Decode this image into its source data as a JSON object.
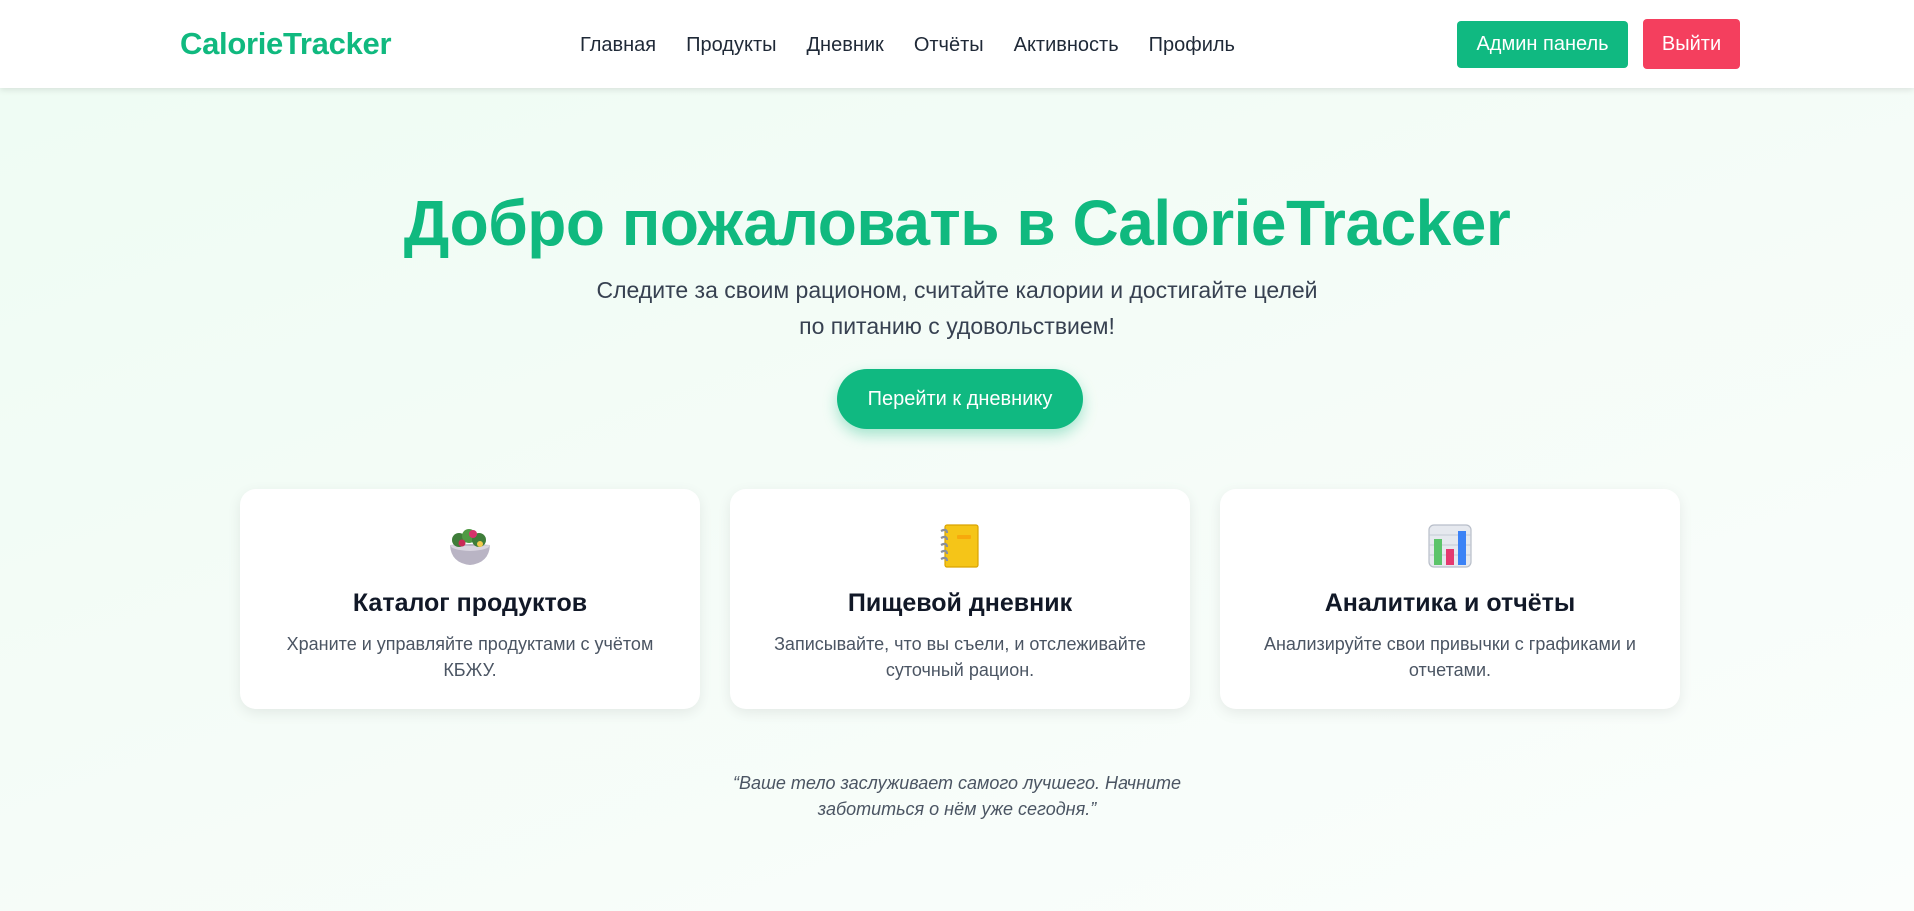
{
  "navbar": {
    "logo": "CalorieTracker",
    "links": [
      {
        "label": "Главная"
      },
      {
        "label": "Продукты"
      },
      {
        "label": "Дневник"
      },
      {
        "label": "Отчёты"
      },
      {
        "label": "Активность"
      },
      {
        "label": "Профиль"
      }
    ],
    "admin_label": "Админ панель",
    "logout_label": "Выйти"
  },
  "hero": {
    "title": "Добро пожаловать в CalorieTracker",
    "subtitle": "Следите за своим рационом, считайте калории и достигайте целей по питанию с удовольствием!",
    "cta_label": "Перейти к дневнику"
  },
  "features": [
    {
      "icon": "salad-icon",
      "title": "Каталог продуктов",
      "text": "Храните и управляйте продуктами с учётом КБЖУ."
    },
    {
      "icon": "notebook-icon",
      "title": "Пищевой дневник",
      "text": "Записывайте, что вы съели, и отслеживайте суточный рацион."
    },
    {
      "icon": "bar-chart-icon",
      "title": "Аналитика и отчёты",
      "text": "Анализируйте свои привычки с графиками и отчетами."
    }
  ],
  "quote": "“Ваше тело заслуживает самого лучшего. Начните заботиться о нём уже сегодня.”",
  "colors": {
    "brand": "#10b981",
    "danger": "#f43f5e",
    "background": "#f0fdf4"
  }
}
